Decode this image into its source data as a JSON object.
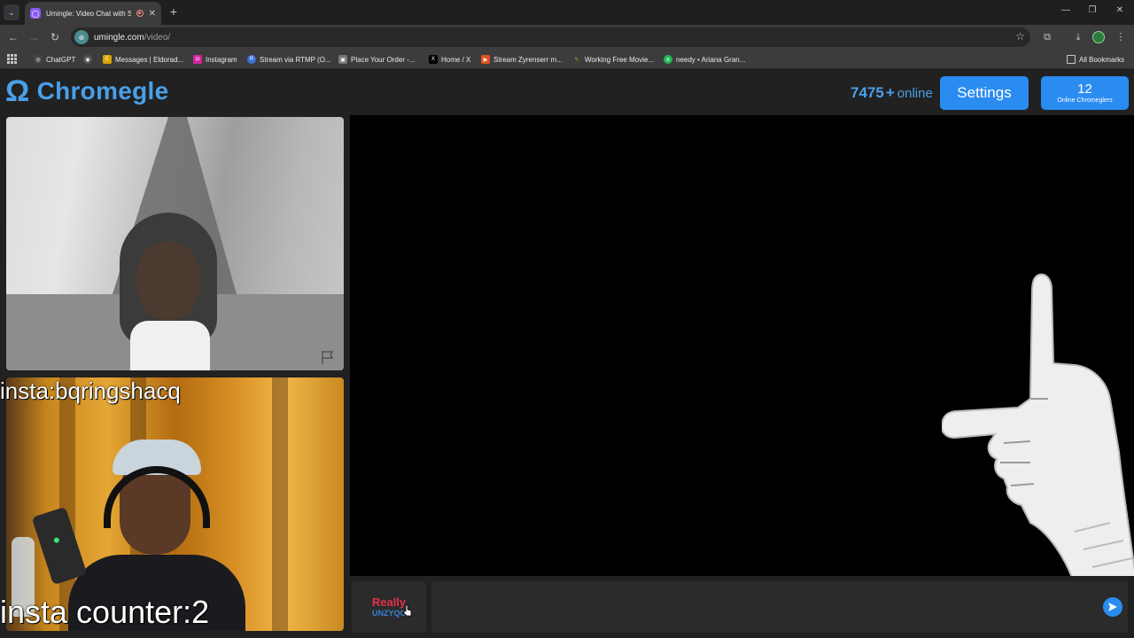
{
  "browser": {
    "tab_title": "Umingle: Video Chat with S",
    "url_host": "umingle.com",
    "url_path": "/video/",
    "bookmarks": [
      {
        "label": "ChatGPT",
        "color": "#444444",
        "icon": "chatgpt-icon"
      },
      {
        "label": "",
        "color": "#555555",
        "icon": "globe-icon"
      },
      {
        "label": "Messages | Eldorad...",
        "color": "#d9a300",
        "icon": "eldorado-icon"
      },
      {
        "label": "Instagram",
        "color": "#d6249f",
        "icon": "instagram-icon"
      },
      {
        "label": "Stream via RTMP (O...",
        "color": "#3b6fd8",
        "icon": "rtmp-icon"
      },
      {
        "label": "Place Your Order -...",
        "color": "#777777",
        "icon": "order-icon"
      },
      {
        "label": "Home / X",
        "color": "#000000",
        "icon": "x-icon"
      },
      {
        "label": "Stream Zyrenserr m...",
        "color": "#e0531f",
        "icon": "stream-icon"
      },
      {
        "label": "Working Free Movie...",
        "color": "#c9a227",
        "icon": "movie-icon"
      },
      {
        "label": "needy • Ariana Gran...",
        "color": "#1db954",
        "icon": "spotify-icon"
      }
    ],
    "all_bookmarks_label": "All Bookmarks"
  },
  "header": {
    "logo_text": "Chromegle",
    "logo_symbol": "Ω",
    "online_count": "7475",
    "online_plus": "+",
    "online_label": "online",
    "settings_label": "Settings",
    "chromeglers_count": "12",
    "chromeglers_label": "Online Chromeglers",
    "accent_color": "#2a8cf0"
  },
  "overlays": {
    "insta_handle": "insta:bqringshacq",
    "counter": "insta counter:2"
  },
  "bottom": {
    "logo_main": "Really",
    "logo_sub": "UNZYQC",
    "chat_placeholder": ""
  }
}
